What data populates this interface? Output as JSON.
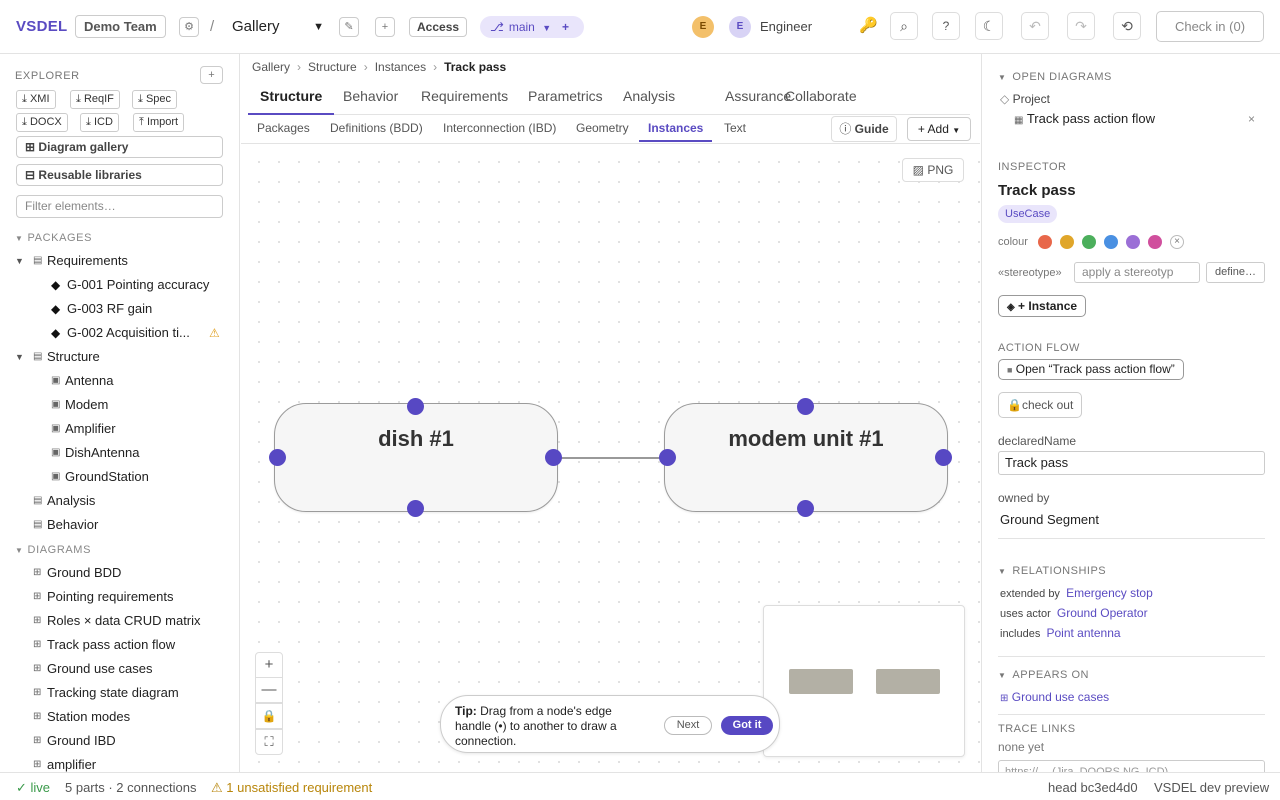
{
  "header": {
    "logo": "VSDEL",
    "team": "Demo Team",
    "project_select": "Gallery",
    "access": "Access",
    "branch": "main",
    "user_initial_1": "E",
    "user_initial_2": "E",
    "user_role": "Engineer",
    "check_in": "Check in (0)",
    "colors": {
      "accent": "#5a4bc2"
    }
  },
  "explorer": {
    "title": "EXPLORER",
    "buttons": [
      "XMI",
      "ReqIF",
      "Spec",
      "DOCX",
      "ICD",
      "Import"
    ],
    "diagram_gallery": "Diagram gallery",
    "reusable_libraries": "Reusable libraries",
    "filter_placeholder": "Filter elements…",
    "packages_title": "PACKAGES",
    "packages": [
      {
        "label": "Requirements"
      },
      {
        "label": "G-001 Pointing accuracy"
      },
      {
        "label": "G-003 RF gain"
      },
      {
        "label": "G-002 Acquisition ti..."
      },
      {
        "label": "Structure"
      },
      {
        "label": "Antenna"
      },
      {
        "label": "Modem"
      },
      {
        "label": "Amplifier"
      },
      {
        "label": "DishAntenna"
      },
      {
        "label": "GroundStation"
      },
      {
        "label": "Analysis"
      },
      {
        "label": "Behavior"
      }
    ],
    "diagrams_title": "DIAGRAMS",
    "diagrams": [
      {
        "label": "Ground BDD"
      },
      {
        "label": "Pointing requirements"
      },
      {
        "label": "Roles × data CRUD matrix"
      },
      {
        "label": "Track pass action flow"
      },
      {
        "label": "Ground use cases"
      },
      {
        "label": "Tracking state diagram"
      },
      {
        "label": "Station modes"
      },
      {
        "label": "Ground IBD"
      },
      {
        "label": "amplifier"
      }
    ]
  },
  "breadcrumb": [
    "Gallery",
    "Structure",
    "Instances",
    "Track pass"
  ],
  "tabs": [
    "Structure",
    "Behavior",
    "Requirements",
    "Parametrics",
    "Analysis",
    "Assurance",
    "Collaborate"
  ],
  "subtabs": [
    "Packages",
    "Definitions (BDD)",
    "Interconnection (IBD)",
    "Geometry",
    "Instances",
    "Text"
  ],
  "guide": "Guide",
  "add": "+ Add",
  "png": "PNG",
  "canvas": {
    "nodes": [
      {
        "label": "dish #1"
      },
      {
        "label": "modem unit #1"
      }
    ],
    "tip_bold": "Tip:",
    "tip_text": "Drag from a node's edge handle (•) to another to draw a connection.",
    "next": "Next",
    "got_it": "Got it"
  },
  "inspector": {
    "open_diagrams_title": "OPEN DIAGRAMS",
    "project": "Project",
    "open_diagram": "Track pass action flow",
    "inspector_title": "INSPECTOR",
    "name": "Track pass",
    "kind": "UseCase",
    "colour_label": "colour",
    "swatch_colors": [
      "#e8674a",
      "#e0a62a",
      "#4caf5c",
      "#4a90e2",
      "#9b6fd6",
      "#d04f9d"
    ],
    "stereotype_label": "«stereotype»",
    "stereotype_placeholder": "apply a stereotyp",
    "define": "define…",
    "instance_btn": "+ Instance",
    "action_flow_title": "ACTION FLOW",
    "open_flow_btn": "Open “Track pass action flow”",
    "check_out": "check out",
    "declared_name_label": "declaredName",
    "declared_name": "Track pass",
    "owned_by_label": "owned by",
    "owned_by": "Ground Segment",
    "relationships_title": "RELATIONSHIPS",
    "relationships": [
      {
        "type": "extended by",
        "target": "Emergency stop"
      },
      {
        "type": "uses actor",
        "target": "Ground Operator"
      },
      {
        "type": "includes",
        "target": "Point antenna"
      }
    ],
    "appears_on_title": "APPEARS ON",
    "appears_on": "Ground use cases",
    "trace_links_title": "TRACE LINKS",
    "trace_none": "none yet",
    "trace_placeholder": "https://… (Jira, DOORS NG, ICD)"
  },
  "status": {
    "live": "live",
    "parts": "5 parts · 2 connections",
    "warning": "1 unsatisfied requirement",
    "head": "head bc3ed4d0",
    "preview": "VSDEL dev preview"
  }
}
